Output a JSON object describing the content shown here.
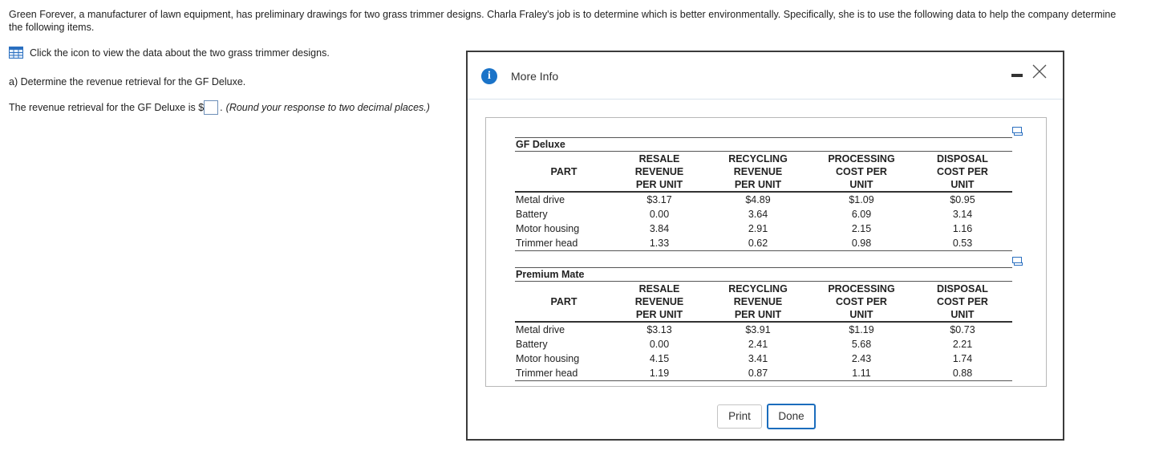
{
  "problem": {
    "intro": "Green Forever, a manufacturer of lawn equipment, has preliminary drawings for two grass trimmer designs. Charla Fraley's job is to determine which is better environmentally. Specifically, she is to use the following data to help the company determine the following items.",
    "data_link": "Click the icon to view the data about the two grass trimmer designs.",
    "question_a": "a) Determine the revenue retrieval for the GF Deluxe.",
    "answer_prefix": "The revenue retrieval for the GF Deluxe is $",
    "answer_value": "",
    "answer_suffix": ".",
    "round_note": "(Round your response to two decimal places.)"
  },
  "modal": {
    "title": "More Info",
    "print_label": "Print",
    "done_label": "Done"
  },
  "tables": [
    {
      "caption": "GF Deluxe",
      "headers": [
        "PART",
        "RESALE\nREVENUE\nPER UNIT",
        "RECYCLING\nREVENUE\nPER UNIT",
        "PROCESSING\nCOST PER\nUNIT",
        "DISPOSAL\nCOST PER\nUNIT"
      ],
      "rows": [
        [
          "Metal drive",
          "$3.17",
          "$4.89",
          "$1.09",
          "$0.95"
        ],
        [
          "Battery",
          "0.00",
          "3.64",
          "6.09",
          "3.14"
        ],
        [
          "Motor housing",
          "3.84",
          "2.91",
          "2.15",
          "1.16"
        ],
        [
          "Trimmer head",
          "1.33",
          "0.62",
          "0.98",
          "0.53"
        ]
      ]
    },
    {
      "caption": "Premium Mate",
      "headers": [
        "PART",
        "RESALE\nREVENUE\nPER UNIT",
        "RECYCLING\nREVENUE\nPER UNIT",
        "PROCESSING\nCOST PER\nUNIT",
        "DISPOSAL\nCOST PER\nUNIT"
      ],
      "rows": [
        [
          "Metal drive",
          "$3.13",
          "$3.91",
          "$1.19",
          "$0.73"
        ],
        [
          "Battery",
          "0.00",
          "2.41",
          "5.68",
          "2.21"
        ],
        [
          "Motor housing",
          "4.15",
          "3.41",
          "2.43",
          "1.74"
        ],
        [
          "Trimmer head",
          "1.19",
          "0.87",
          "1.11",
          "0.88"
        ]
      ]
    }
  ],
  "icons": {
    "data": "table-grid-icon",
    "info": "info-icon",
    "minimize": "minimize-icon",
    "close": "close-icon",
    "copy": "copy-icon"
  },
  "colors": {
    "accent": "#1b6dbd",
    "info_blue": "#1a73c8",
    "modal_border": "#3b3b3b"
  }
}
